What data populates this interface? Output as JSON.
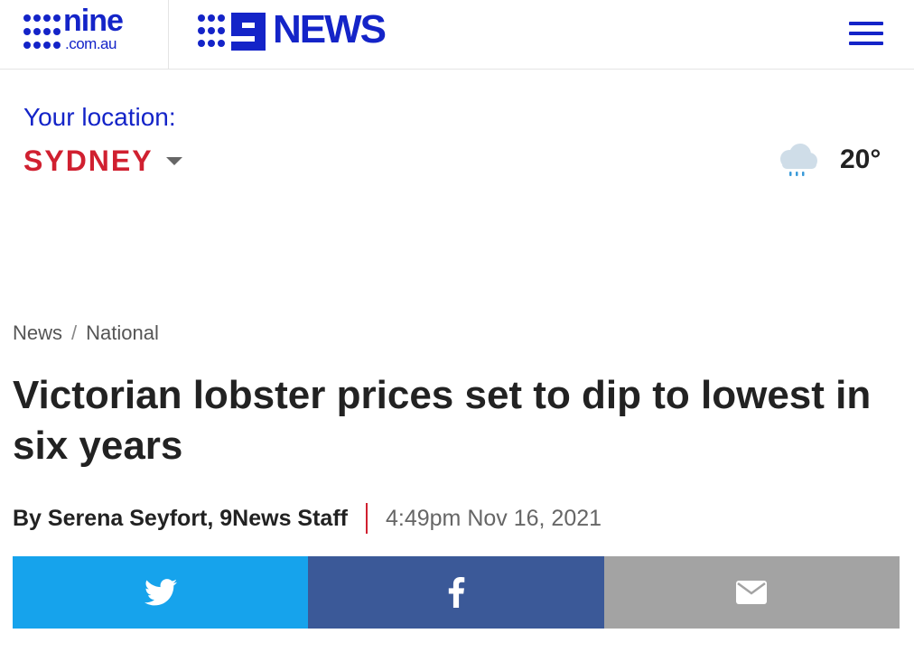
{
  "header": {
    "nine_logo": {
      "word": "nine",
      "domain": ".com.au"
    },
    "news_logo": {
      "word": "NEWS"
    },
    "menu_icon": "hamburger-menu-icon",
    "brand_color": "#1424c8"
  },
  "location": {
    "label": "Your location:",
    "city": "SYDNEY",
    "city_color": "#d02030"
  },
  "weather": {
    "icon": "rain-cloud-icon",
    "temperature": "20°"
  },
  "breadcrumb": {
    "items": [
      "News",
      "National"
    ],
    "separator": "/"
  },
  "article": {
    "headline": "Victorian lobster prices set to dip to lowest in six years",
    "author": "By Serena Seyfort, 9News Staff",
    "date": "4:49pm Nov 16, 2021"
  },
  "share": {
    "buttons": [
      {
        "name": "twitter",
        "icon": "twitter-bird-icon",
        "color": "#16a3ec"
      },
      {
        "name": "facebook",
        "icon": "facebook-f-icon",
        "color": "#3b5998"
      },
      {
        "name": "email",
        "icon": "envelope-icon",
        "color": "#a3a3a3"
      }
    ]
  }
}
